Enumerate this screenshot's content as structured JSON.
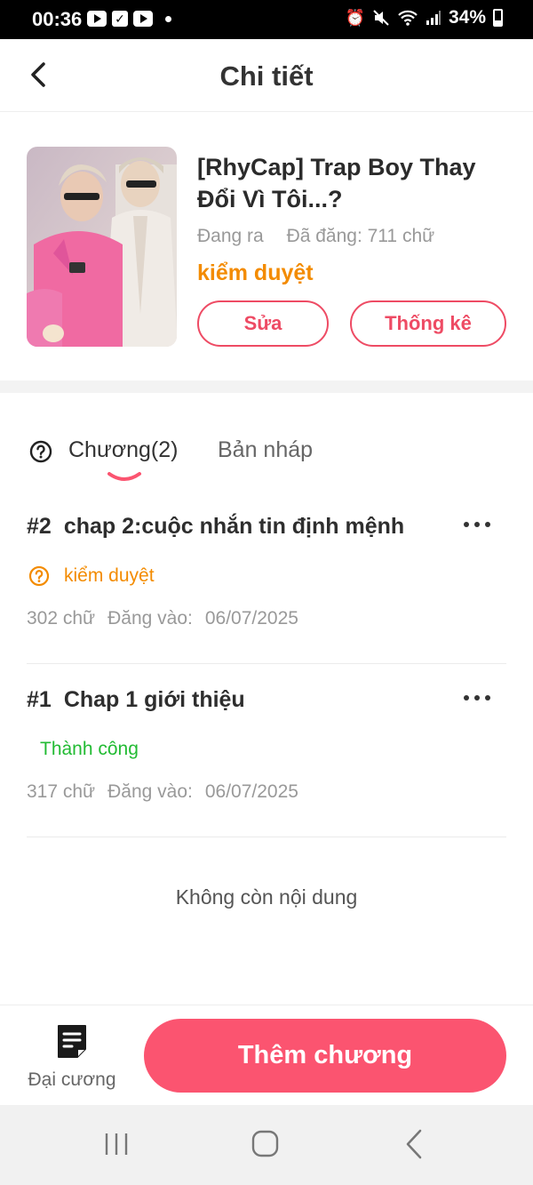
{
  "status_bar": {
    "time": "00:36",
    "battery": "34%"
  },
  "header": {
    "title": "Chi tiết",
    "back_icon": "chevron-left-icon"
  },
  "book": {
    "title": "[RhyCap] Trap Boy Thay Đổi Vì Tôi...?",
    "state": "Đang ra",
    "posted": "Đã đăng: 711 chữ",
    "review_status": "kiểm duyệt",
    "edit_label": "Sửa",
    "stats_label": "Thống kê"
  },
  "tabs": {
    "chapters_label": "Chương(2)",
    "drafts_label": "Bản nháp",
    "help_icon": "question-circle-icon"
  },
  "chapters": [
    {
      "number": "#2",
      "title": "chap 2:cuộc nhắn tin định mệnh",
      "status": "kiểm duyệt",
      "words": "302 chữ",
      "posted_label": "Đăng vào:",
      "date": "06/07/2025"
    },
    {
      "number": "#1",
      "title": "Chap 1 giới thiệu",
      "status": "Thành công",
      "words": "317 chữ",
      "posted_label": "Đăng vào:",
      "date": "06/07/2025"
    }
  ],
  "empty_text": "Không còn nội dung",
  "bottom": {
    "outline_label": "Đại cương",
    "add_chapter_label": "Thêm chương"
  },
  "colors": {
    "accent": "#fb5470",
    "review": "#f38b00",
    "success": "#22bb33"
  }
}
